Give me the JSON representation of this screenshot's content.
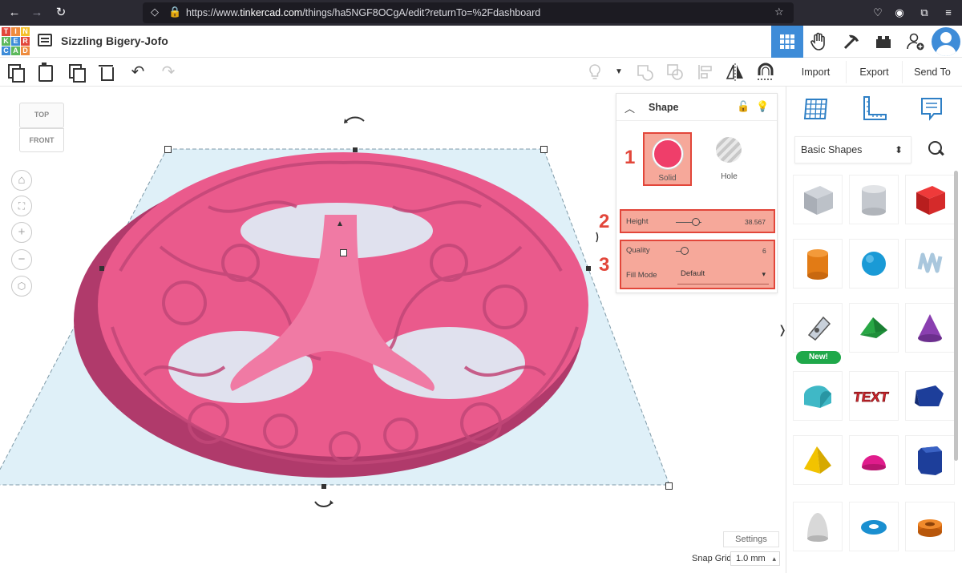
{
  "browser": {
    "url_prefix": "https://www.",
    "url_domain": "tinkercad.com",
    "url_rest": "/things/ha5NGF8OCgA/edit?returnTo=%2Fdashboard"
  },
  "app": {
    "logo_letters": [
      "T",
      "I",
      "N",
      "K",
      "E",
      "R",
      "C",
      "A",
      "D"
    ],
    "title": "Sizzling Bigery-Jofo"
  },
  "right_tabs": {
    "import": "Import",
    "export": "Export",
    "send_to": "Send To"
  },
  "viewcube": {
    "top": "TOP",
    "front": "FRONT"
  },
  "inspector": {
    "title": "Shape",
    "solid_label": "Solid",
    "hole_label": "Hole",
    "height_label": "Height",
    "height_value": "38.567",
    "quality_label": "Quality",
    "quality_value": "6",
    "fill_mode_label": "Fill Mode",
    "fill_mode_value": "Default",
    "callout_1": "1",
    "callout_2": "2",
    "callout_3": "3"
  },
  "workplane": {
    "settings_label": "Settings",
    "snap_grid_label": "Snap Grid",
    "snap_grid_value": "1.0 mm"
  },
  "library": {
    "category": "Basic Shapes",
    "new_badge": "New!"
  },
  "colors": {
    "accent": "#3e8cd8",
    "shape_pink": "#ef3e6a",
    "callout_red": "#e2463a",
    "workplane": "#dff0f8"
  }
}
